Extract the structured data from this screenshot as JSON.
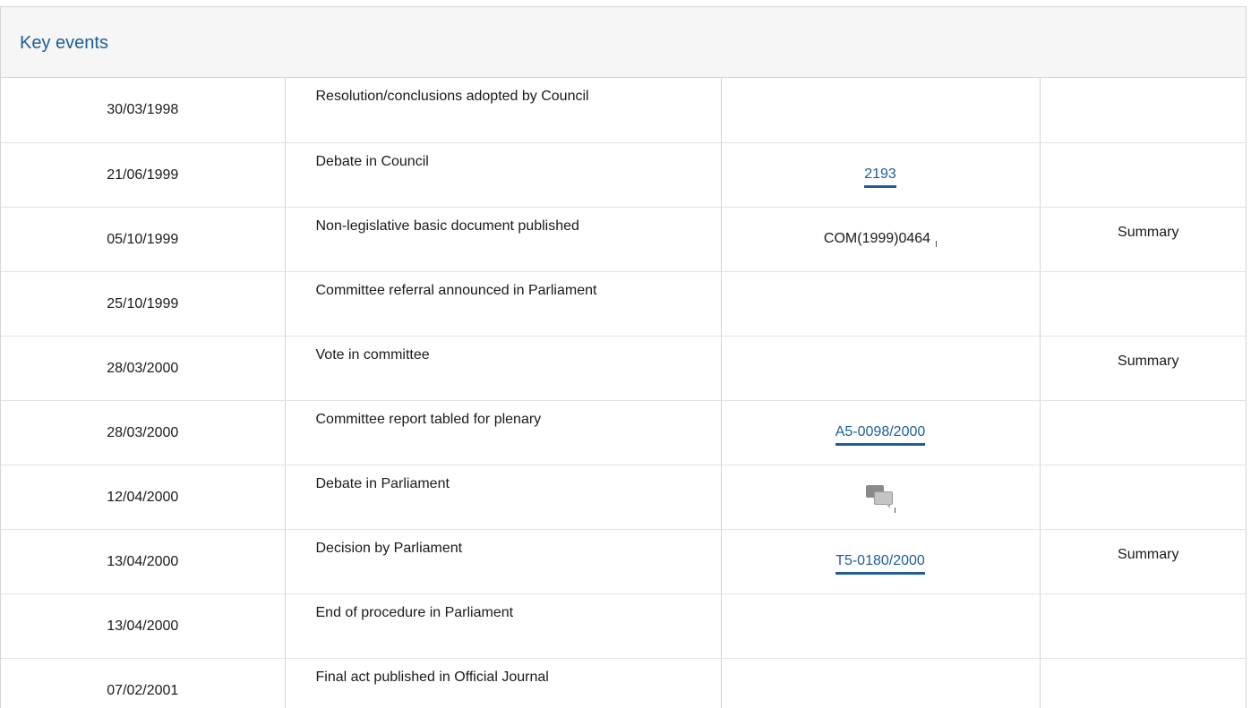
{
  "section": {
    "title": "Key events"
  },
  "events": [
    {
      "date": "30/03/1998",
      "event": "Resolution/conclusions adopted by Council",
      "doc": "",
      "doc_type": "none",
      "summary": ""
    },
    {
      "date": "21/06/1999",
      "event": "Debate in Council",
      "doc": "2193",
      "doc_type": "link",
      "summary": ""
    },
    {
      "date": "05/10/1999",
      "event": "Non-legislative basic document published",
      "doc": "COM(1999)0464",
      "doc_type": "text",
      "summary": "Summary"
    },
    {
      "date": "25/10/1999",
      "event": "Committee referral announced in Parliament",
      "doc": "",
      "doc_type": "none",
      "summary": ""
    },
    {
      "date": "28/03/2000",
      "event": "Vote in committee",
      "doc": "",
      "doc_type": "none",
      "summary": "Summary"
    },
    {
      "date": "28/03/2000",
      "event": "Committee report tabled for plenary",
      "doc": "A5-0098/2000",
      "doc_type": "link",
      "summary": ""
    },
    {
      "date": "12/04/2000",
      "event": "Debate in Parliament",
      "doc": "",
      "doc_type": "icon",
      "icon": "debate-chat-icon",
      "summary": ""
    },
    {
      "date": "13/04/2000",
      "event": "Decision by Parliament",
      "doc": "T5-0180/2000",
      "doc_type": "link",
      "summary": "Summary"
    },
    {
      "date": "13/04/2000",
      "event": "End of procedure in Parliament",
      "doc": "",
      "doc_type": "none",
      "summary": ""
    },
    {
      "date": "07/02/2001",
      "event": "Final act published in Official Journal",
      "doc": "",
      "doc_type": "none",
      "summary": ""
    }
  ],
  "colors": {
    "accent": "#1d5d9b",
    "header_bg": "#f6f6f6",
    "border": "#d4d4d4"
  }
}
